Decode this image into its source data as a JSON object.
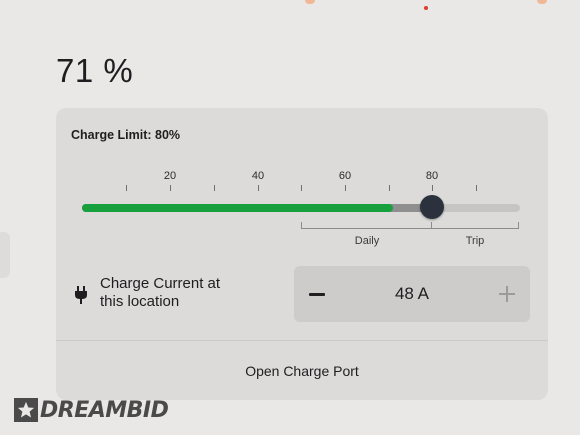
{
  "battery": {
    "percent_text": "71 %",
    "percent": 71
  },
  "charge_limit": {
    "label": "Charge Limit: 80%",
    "value": 80,
    "tick_labels": [
      "20",
      "40",
      "60",
      "80"
    ],
    "ranges": {
      "daily": "Daily",
      "trip": "Trip"
    }
  },
  "charge_current": {
    "label_line1": "Charge Current at",
    "label_line2": "this location",
    "value_text": "48 A"
  },
  "open_port": {
    "label": "Open Charge Port"
  },
  "watermark": {
    "text": "DREAMBID"
  },
  "colors": {
    "charge_fill": "#18a03e",
    "thumb": "#2c323d",
    "card_bg": "#dcdbd9"
  },
  "icons": {
    "plug": "plug-icon",
    "minus": "minus-icon",
    "plus": "plus-icon",
    "star": "star-icon"
  }
}
